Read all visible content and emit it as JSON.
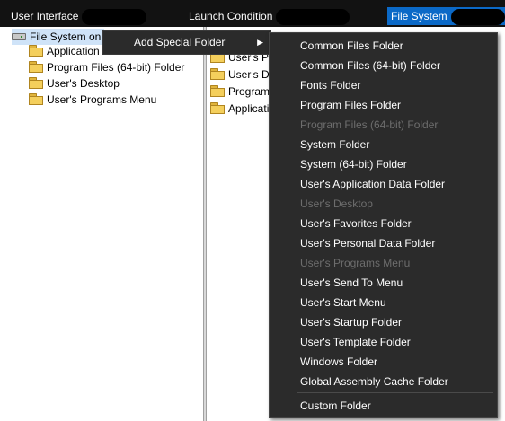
{
  "tabs": [
    {
      "label": "User Interface",
      "active": false
    },
    {
      "label": "Launch Condition",
      "active": false
    },
    {
      "label": "File System",
      "active": true
    }
  ],
  "left_tree": {
    "root_label": "File System on",
    "items": [
      {
        "label": "Application Folder",
        "icon": "folder-icon"
      },
      {
        "label": "Program Files (64-bit) Folder",
        "icon": "folder-icon"
      },
      {
        "label": "User's Desktop",
        "icon": "folder-icon"
      },
      {
        "label": "User's Programs Menu",
        "icon": "folder-icon"
      }
    ]
  },
  "right_list": {
    "items": [
      {
        "label": "User's Pro"
      },
      {
        "label": "User's De"
      },
      {
        "label": "Program"
      },
      {
        "label": "Applicati"
      }
    ]
  },
  "context_menu": {
    "add_special_folder": "Add Special Folder",
    "submenu": [
      {
        "label": "Common Files Folder",
        "disabled": false
      },
      {
        "label": "Common Files (64-bit) Folder",
        "disabled": false
      },
      {
        "label": "Fonts Folder",
        "disabled": false
      },
      {
        "label": "Program Files Folder",
        "disabled": false
      },
      {
        "label": "Program Files (64-bit) Folder",
        "disabled": true
      },
      {
        "label": "System Folder",
        "disabled": false
      },
      {
        "label": "System (64-bit) Folder",
        "disabled": false
      },
      {
        "label": "User's Application Data Folder",
        "disabled": false
      },
      {
        "label": "User's Desktop",
        "disabled": true
      },
      {
        "label": "User's Favorites Folder",
        "disabled": false
      },
      {
        "label": "User's Personal Data Folder",
        "disabled": false
      },
      {
        "label": "User's Programs Menu",
        "disabled": true
      },
      {
        "label": "User's Send To Menu",
        "disabled": false
      },
      {
        "label": "User's Start Menu",
        "disabled": false
      },
      {
        "label": "User's Startup Folder",
        "disabled": false
      },
      {
        "label": "User's Template Folder",
        "disabled": false
      },
      {
        "label": "Windows Folder",
        "disabled": false
      },
      {
        "label": "Global Assembly Cache Folder",
        "disabled": false
      }
    ],
    "custom_folder": "Custom Folder"
  },
  "colors": {
    "tab_active_bg": "#0b69c7",
    "menu_bg": "#2b2b2b",
    "selection_bg": "#cfe3f8"
  }
}
